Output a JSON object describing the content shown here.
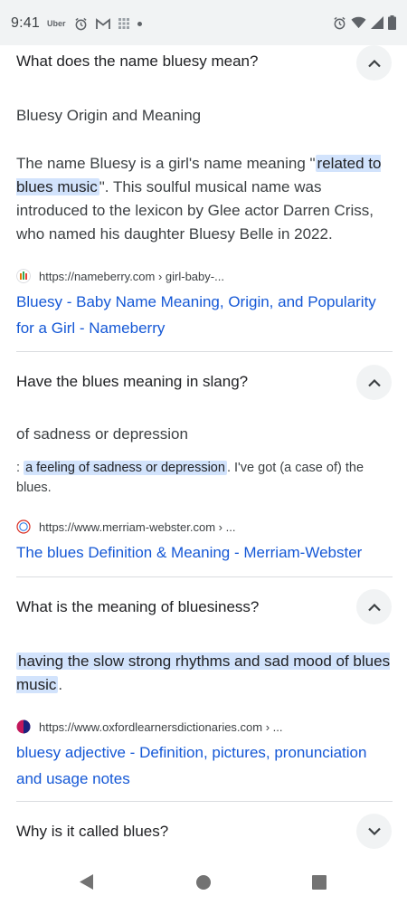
{
  "status_bar": {
    "time": "9:41",
    "uber_label": "Uber",
    "left_icons": [
      "uber-icon",
      "alarm-icon",
      "gmail-icon",
      "grid-icon",
      "dot-icon"
    ],
    "right_icons": [
      "alarm-icon",
      "wifi-icon",
      "signal-icon",
      "battery-icon"
    ]
  },
  "faqs": [
    {
      "question": "What does the name bluesy mean?",
      "expanded": true,
      "answer_heading": "Bluesy Origin and Meaning",
      "answer_pre": "The name Bluesy is a girl's name meaning \"",
      "answer_highlight": "related to blues music",
      "answer_post": "\". This soulful musical name was introduced to the lexicon by Glee actor Darren Criss, who named his daughter Bluesy Belle in 2022.",
      "source_url": "https://nameberry.com › girl-baby-...",
      "link_title": "Bluesy - Baby Name Meaning, Origin, and Popularity for a Girl - Nameberry"
    },
    {
      "question": "Have the blues meaning in slang?",
      "expanded": true,
      "answer_heading": "of sadness or depression",
      "answer_pre": ": ",
      "answer_highlight": "a feeling of sadness or depression",
      "answer_post": ". I've got (a case of) the blues.",
      "source_url": "https://www.merriam-webster.com › ...",
      "link_title": "The blues Definition & Meaning - Merriam-Webster"
    },
    {
      "question": "What is the meaning of bluesiness?",
      "expanded": true,
      "answer_highlight": "having the slow strong rhythms and sad mood of blues music",
      "answer_post": ".",
      "source_url": "https://www.oxfordlearnersdictionaries.com › ...",
      "link_title": "bluesy adjective - Definition, pictures, pronunciation and usage notes"
    },
    {
      "question": "Why is it called blues?",
      "expanded": false
    }
  ],
  "nav_bar": {
    "buttons": [
      "back-icon",
      "home-icon",
      "recents-icon"
    ]
  },
  "colors": {
    "link": "#1558d6",
    "highlight": "#d2e3fc",
    "chevron_bg": "#f1f3f4",
    "status_bar_bg": "#f1f3f4"
  }
}
